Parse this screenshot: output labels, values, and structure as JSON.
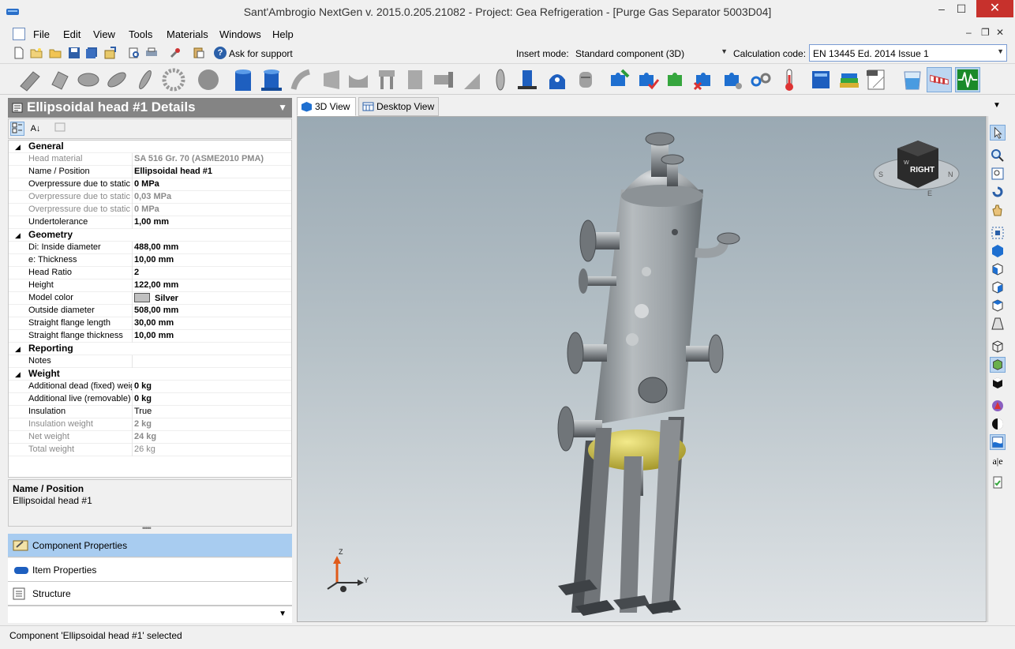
{
  "window": {
    "title": "Sant'Ambrogio NextGen  v. 2015.0.205.21082 - Project: Gea Refrigeration - [Purge Gas Separator 5003D04]",
    "min": "–",
    "max": "☐",
    "close": "✕"
  },
  "menu": {
    "items": [
      "File",
      "Edit",
      "View",
      "Tools",
      "Materials",
      "Windows",
      "Help"
    ],
    "mdi_min": "–",
    "mdi_restore": "❐",
    "mdi_close": "✕"
  },
  "toolbar": {
    "help_glyph": "?",
    "ask_support": "Ask for support",
    "insert_mode_label": "Insert mode:",
    "insert_mode_value": "Standard component (3D)",
    "calc_code_label": "Calculation code:",
    "calc_code_value": "EN 13445 Ed. 2014 Issue 1"
  },
  "details": {
    "title": "Ellipsoidal head #1 Details",
    "pin": "▼",
    "sorted_glyph": "A↓"
  },
  "properties": {
    "categories": [
      {
        "name": "General",
        "rows": [
          {
            "label": "Head material",
            "value": "SA 516 Gr. 70 (ASME2010 PMA)",
            "grey": true,
            "bold": true
          },
          {
            "label": "Name / Position",
            "value": "Ellipsoidal head #1",
            "grey": false,
            "bold": true
          },
          {
            "label": "Overpressure due to static",
            "value": "0 MPa",
            "grey": false,
            "bold": true
          },
          {
            "label": "Overpressure due to static",
            "value": "0,03 MPa",
            "grey": true,
            "bold": true
          },
          {
            "label": "Overpressure due to static",
            "value": "0 MPa",
            "grey": true,
            "bold": true
          },
          {
            "label": "Undertolerance",
            "value": "1,00 mm",
            "grey": false,
            "bold": true
          }
        ]
      },
      {
        "name": "Geometry",
        "rows": [
          {
            "label": "Di:  Inside diameter",
            "value": "488,00 mm",
            "grey": false,
            "bold": true
          },
          {
            "label": "e:  Thickness",
            "value": "10,00 mm",
            "grey": false,
            "bold": true
          },
          {
            "label": "Head Ratio",
            "value": "2",
            "grey": false,
            "bold": true
          },
          {
            "label": "Height",
            "value": "122,00 mm",
            "grey": false,
            "bold": true
          },
          {
            "label": "Model color",
            "value": "Silver",
            "grey": false,
            "bold": true,
            "swatch": "#c0c0c0"
          },
          {
            "label": "Outside diameter",
            "value": "508,00 mm",
            "grey": false,
            "bold": true
          },
          {
            "label": "Straight flange length",
            "value": "30,00 mm",
            "grey": false,
            "bold": true
          },
          {
            "label": "Straight flange thickness",
            "value": "10,00 mm",
            "grey": false,
            "bold": true
          }
        ]
      },
      {
        "name": "Reporting",
        "rows": [
          {
            "label": "Notes",
            "value": "",
            "grey": false,
            "bold": false
          }
        ]
      },
      {
        "name": "Weight",
        "rows": [
          {
            "label": "Additional dead (fixed) weight",
            "value": "0 kg",
            "grey": false,
            "bold": true
          },
          {
            "label": "Additional live (removable)",
            "value": "0 kg",
            "grey": false,
            "bold": true
          },
          {
            "label": "Insulation",
            "value": "True",
            "grey": false,
            "bold": false
          },
          {
            "label": "Insulation weight",
            "value": "2 kg",
            "grey": true,
            "bold": true
          },
          {
            "label": "Net weight",
            "value": "24 kg",
            "grey": true,
            "bold": true
          },
          {
            "label": "Total weight",
            "value": "26 kg",
            "grey": true,
            "bold": false
          }
        ]
      }
    ]
  },
  "description": {
    "title": "Name / Position",
    "value": "Ellipsoidal head #1"
  },
  "splitter_glyph": "•••••",
  "nav": {
    "items": [
      "Component Properties",
      "Item Properties",
      "Structure"
    ],
    "more": "▼"
  },
  "tabs": {
    "items": [
      "3D View",
      "Desktop View"
    ],
    "menu": "▼"
  },
  "view": {
    "cube_label": "RIGHT",
    "compass_s": "S",
    "compass_n": "N",
    "compass_e": "E",
    "compass_w": "W",
    "axis_z": "Z",
    "axis_y": "Y",
    "text_tool": "a|e"
  },
  "status": {
    "text": "Component 'Ellipsoidal head #1' selected"
  }
}
